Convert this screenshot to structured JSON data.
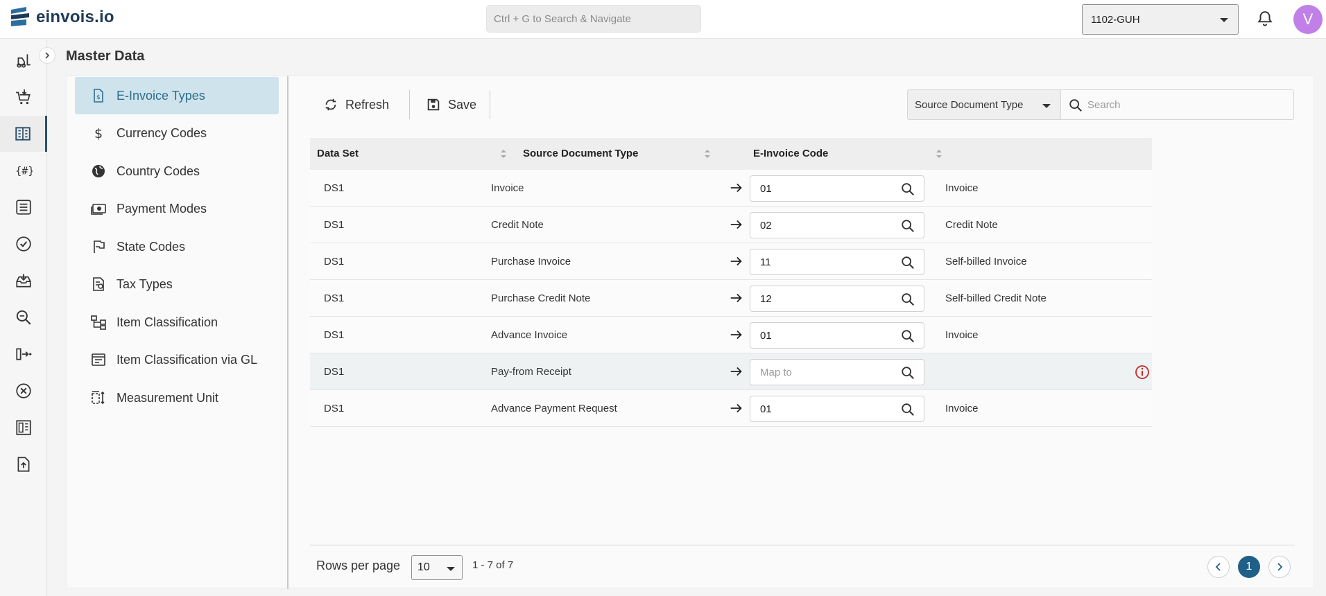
{
  "brand": {
    "name": "einvois.io"
  },
  "header": {
    "search_placeholder": "Ctrl + G to Search & Navigate",
    "company": "1102-GUH",
    "avatar_initial": "V"
  },
  "page": {
    "title": "Master Data"
  },
  "sidebar": {
    "items": [
      {
        "label": "E-Invoice Types",
        "icon": "invoice-doc-icon",
        "active": true
      },
      {
        "label": "Currency Codes",
        "icon": "dollar-icon"
      },
      {
        "label": "Country Codes",
        "icon": "globe-icon"
      },
      {
        "label": "Payment Modes",
        "icon": "cash-icon"
      },
      {
        "label": "State Codes",
        "icon": "flag-icon"
      },
      {
        "label": "Tax Types",
        "icon": "tax-doc-icon"
      },
      {
        "label": "Item Classification",
        "icon": "hierarchy-icon"
      },
      {
        "label": "Item Classification via GL",
        "icon": "list-panel-icon"
      },
      {
        "label": "Measurement Unit",
        "icon": "measure-icon"
      }
    ]
  },
  "toolbar": {
    "refresh_label": "Refresh",
    "save_label": "Save",
    "filter_selected": "Source Document Type",
    "search_placeholder": "Search"
  },
  "table": {
    "columns": [
      "Data Set",
      "Source Document Type",
      "E-Invoice Code"
    ],
    "rows": [
      {
        "data_set": "DS1",
        "source": "Invoice",
        "code": "01",
        "description": "Invoice"
      },
      {
        "data_set": "DS1",
        "source": "Credit Note",
        "code": "02",
        "description": "Credit Note"
      },
      {
        "data_set": "DS1",
        "source": "Purchase Invoice",
        "code": "11",
        "description": "Self-billed Invoice"
      },
      {
        "data_set": "DS1",
        "source": "Purchase Credit Note",
        "code": "12",
        "description": "Self-billed Credit Note"
      },
      {
        "data_set": "DS1",
        "source": "Advance Invoice",
        "code": "01",
        "description": "Invoice"
      },
      {
        "data_set": "DS1",
        "source": "Pay-from Receipt",
        "code": "",
        "placeholder": "Map to",
        "description": "",
        "warning": true
      },
      {
        "data_set": "DS1",
        "source": "Advance Payment Request",
        "code": "01",
        "description": "Invoice"
      }
    ]
  },
  "pagination": {
    "rows_per_page_label": "Rows per page",
    "rows_per_page": "10",
    "range": "1 - 7 of 7",
    "current_page": "1"
  },
  "colors": {
    "accent": "#1f5f88",
    "active_nav_bg": "#cfe3ec",
    "warning": "#c62828",
    "avatar": "#c17fe8"
  }
}
